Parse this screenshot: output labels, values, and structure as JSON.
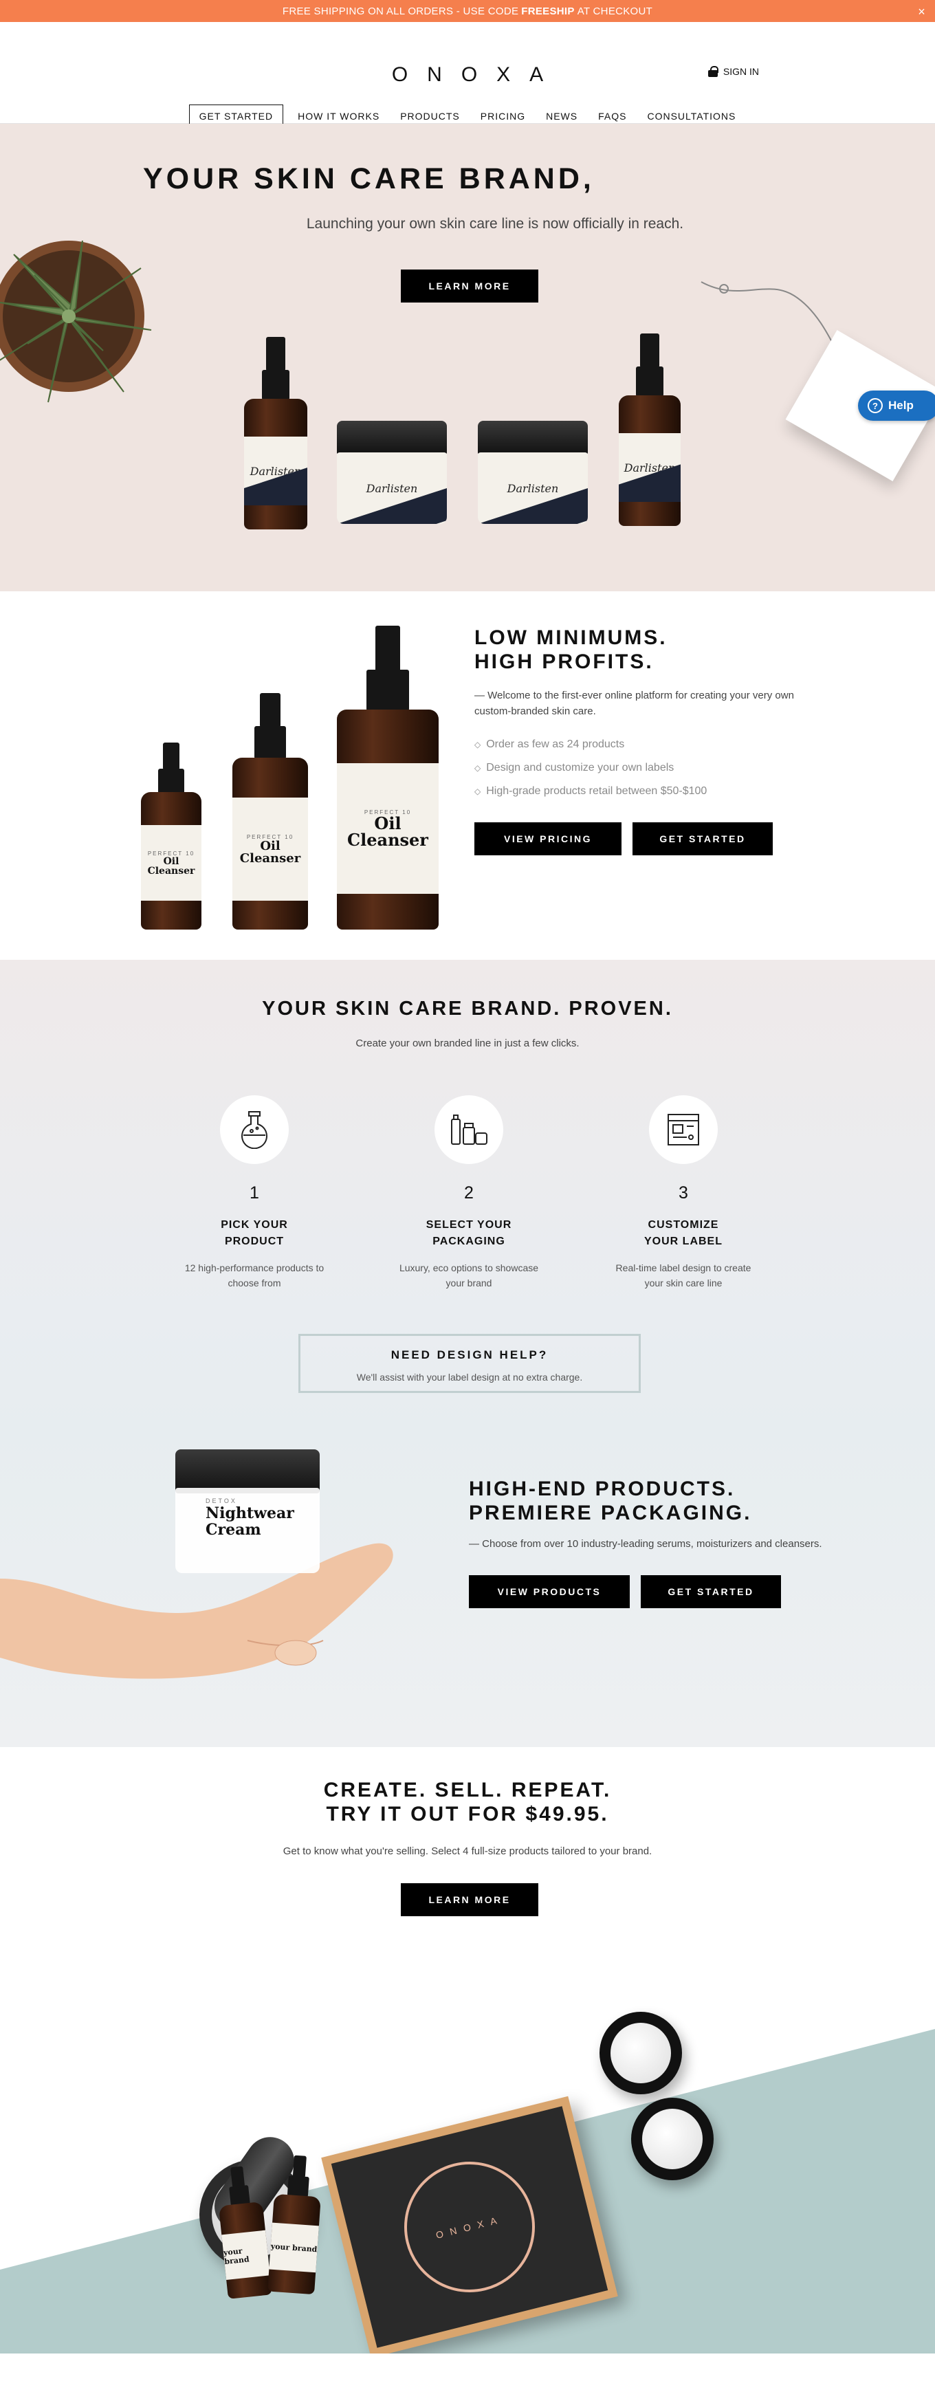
{
  "promo": {
    "prefix": "FREE SHIPPING ON ALL ORDERS - USE CODE",
    "code": "FREESHIP",
    "suffix": "AT CHECKOUT",
    "close": "×"
  },
  "header": {
    "logo": "ONOXA",
    "signin": "SIGN IN",
    "nav": [
      "GET STARTED",
      "HOW IT WORKS",
      "PRODUCTS",
      "PRICING",
      "NEWS",
      "FAQS",
      "CONSULTATIONS"
    ]
  },
  "hero": {
    "title": "YOUR SKIN CARE BRAND,",
    "subtitle": "Launching your own skin care line is now officially in reach.",
    "cta": "LEARN MORE",
    "product_brand": "Darlisten",
    "help": "Help"
  },
  "minimums": {
    "title_line1": "LOW MINIMUMS.",
    "title_line2": "HIGH PROFITS.",
    "lead": "— Welcome to the first-ever online platform for creating your very own custom-branded skin care.",
    "bullets": [
      "Order as few as 24 products",
      "Design and customize your own labels",
      "High-grade products retail between $50-$100"
    ],
    "btn_pricing": "VIEW PRICING",
    "btn_start": "GET STARTED",
    "bottle_brand": "PERFECT 10",
    "bottle_product_line1": "Oil",
    "bottle_product_line2": "Cleanser"
  },
  "proven": {
    "title": "YOUR SKIN CARE BRAND. PROVEN.",
    "subtitle": "Create your own branded line in just a few clicks.",
    "steps": [
      {
        "num": "1",
        "title_line1": "PICK YOUR",
        "title_line2": "PRODUCT",
        "desc_line1": "12 high-performance products to",
        "desc_line2": "choose from"
      },
      {
        "num": "2",
        "title_line1": "SELECT YOUR",
        "title_line2": "PACKAGING",
        "desc_line1": "Luxury, eco options to showcase",
        "desc_line2": "your brand"
      },
      {
        "num": "3",
        "title_line1": "CUSTOMIZE",
        "title_line2": "YOUR LABEL",
        "desc_line1": "Real-time label design to create",
        "desc_line2": "your skin care line"
      }
    ],
    "design_title": "NEED DESIGN HELP?",
    "design_sub": "We'll assist with your label design at no extra charge."
  },
  "premiere": {
    "title_line1": "HIGH-END PRODUCTS.",
    "title_line2": "PREMIERE PACKAGING.",
    "lead": "— Choose from over 10 industry-leading serums, moisturizers and cleansers.",
    "btn_products": "VIEW PRODUCTS",
    "btn_start": "GET STARTED",
    "jar_small": "DETOX",
    "jar_line1": "Nightwear",
    "jar_line2": "Cream"
  },
  "trial": {
    "title_line1": "CREATE. SELL. REPEAT.",
    "title_line2": "TRY IT OUT FOR $49.95.",
    "subtitle": "Get to know what you're selling. Select 4 full-size products tailored to your brand.",
    "cta": "LEARN MORE",
    "box_logo": "ONOXA",
    "bottle_text": "your brand"
  },
  "colors": {
    "promo_bg": "#f57f4d",
    "hero_bg": "#efe4e0",
    "help_blue": "#1b6fc1",
    "teal": "#b3cccb"
  }
}
